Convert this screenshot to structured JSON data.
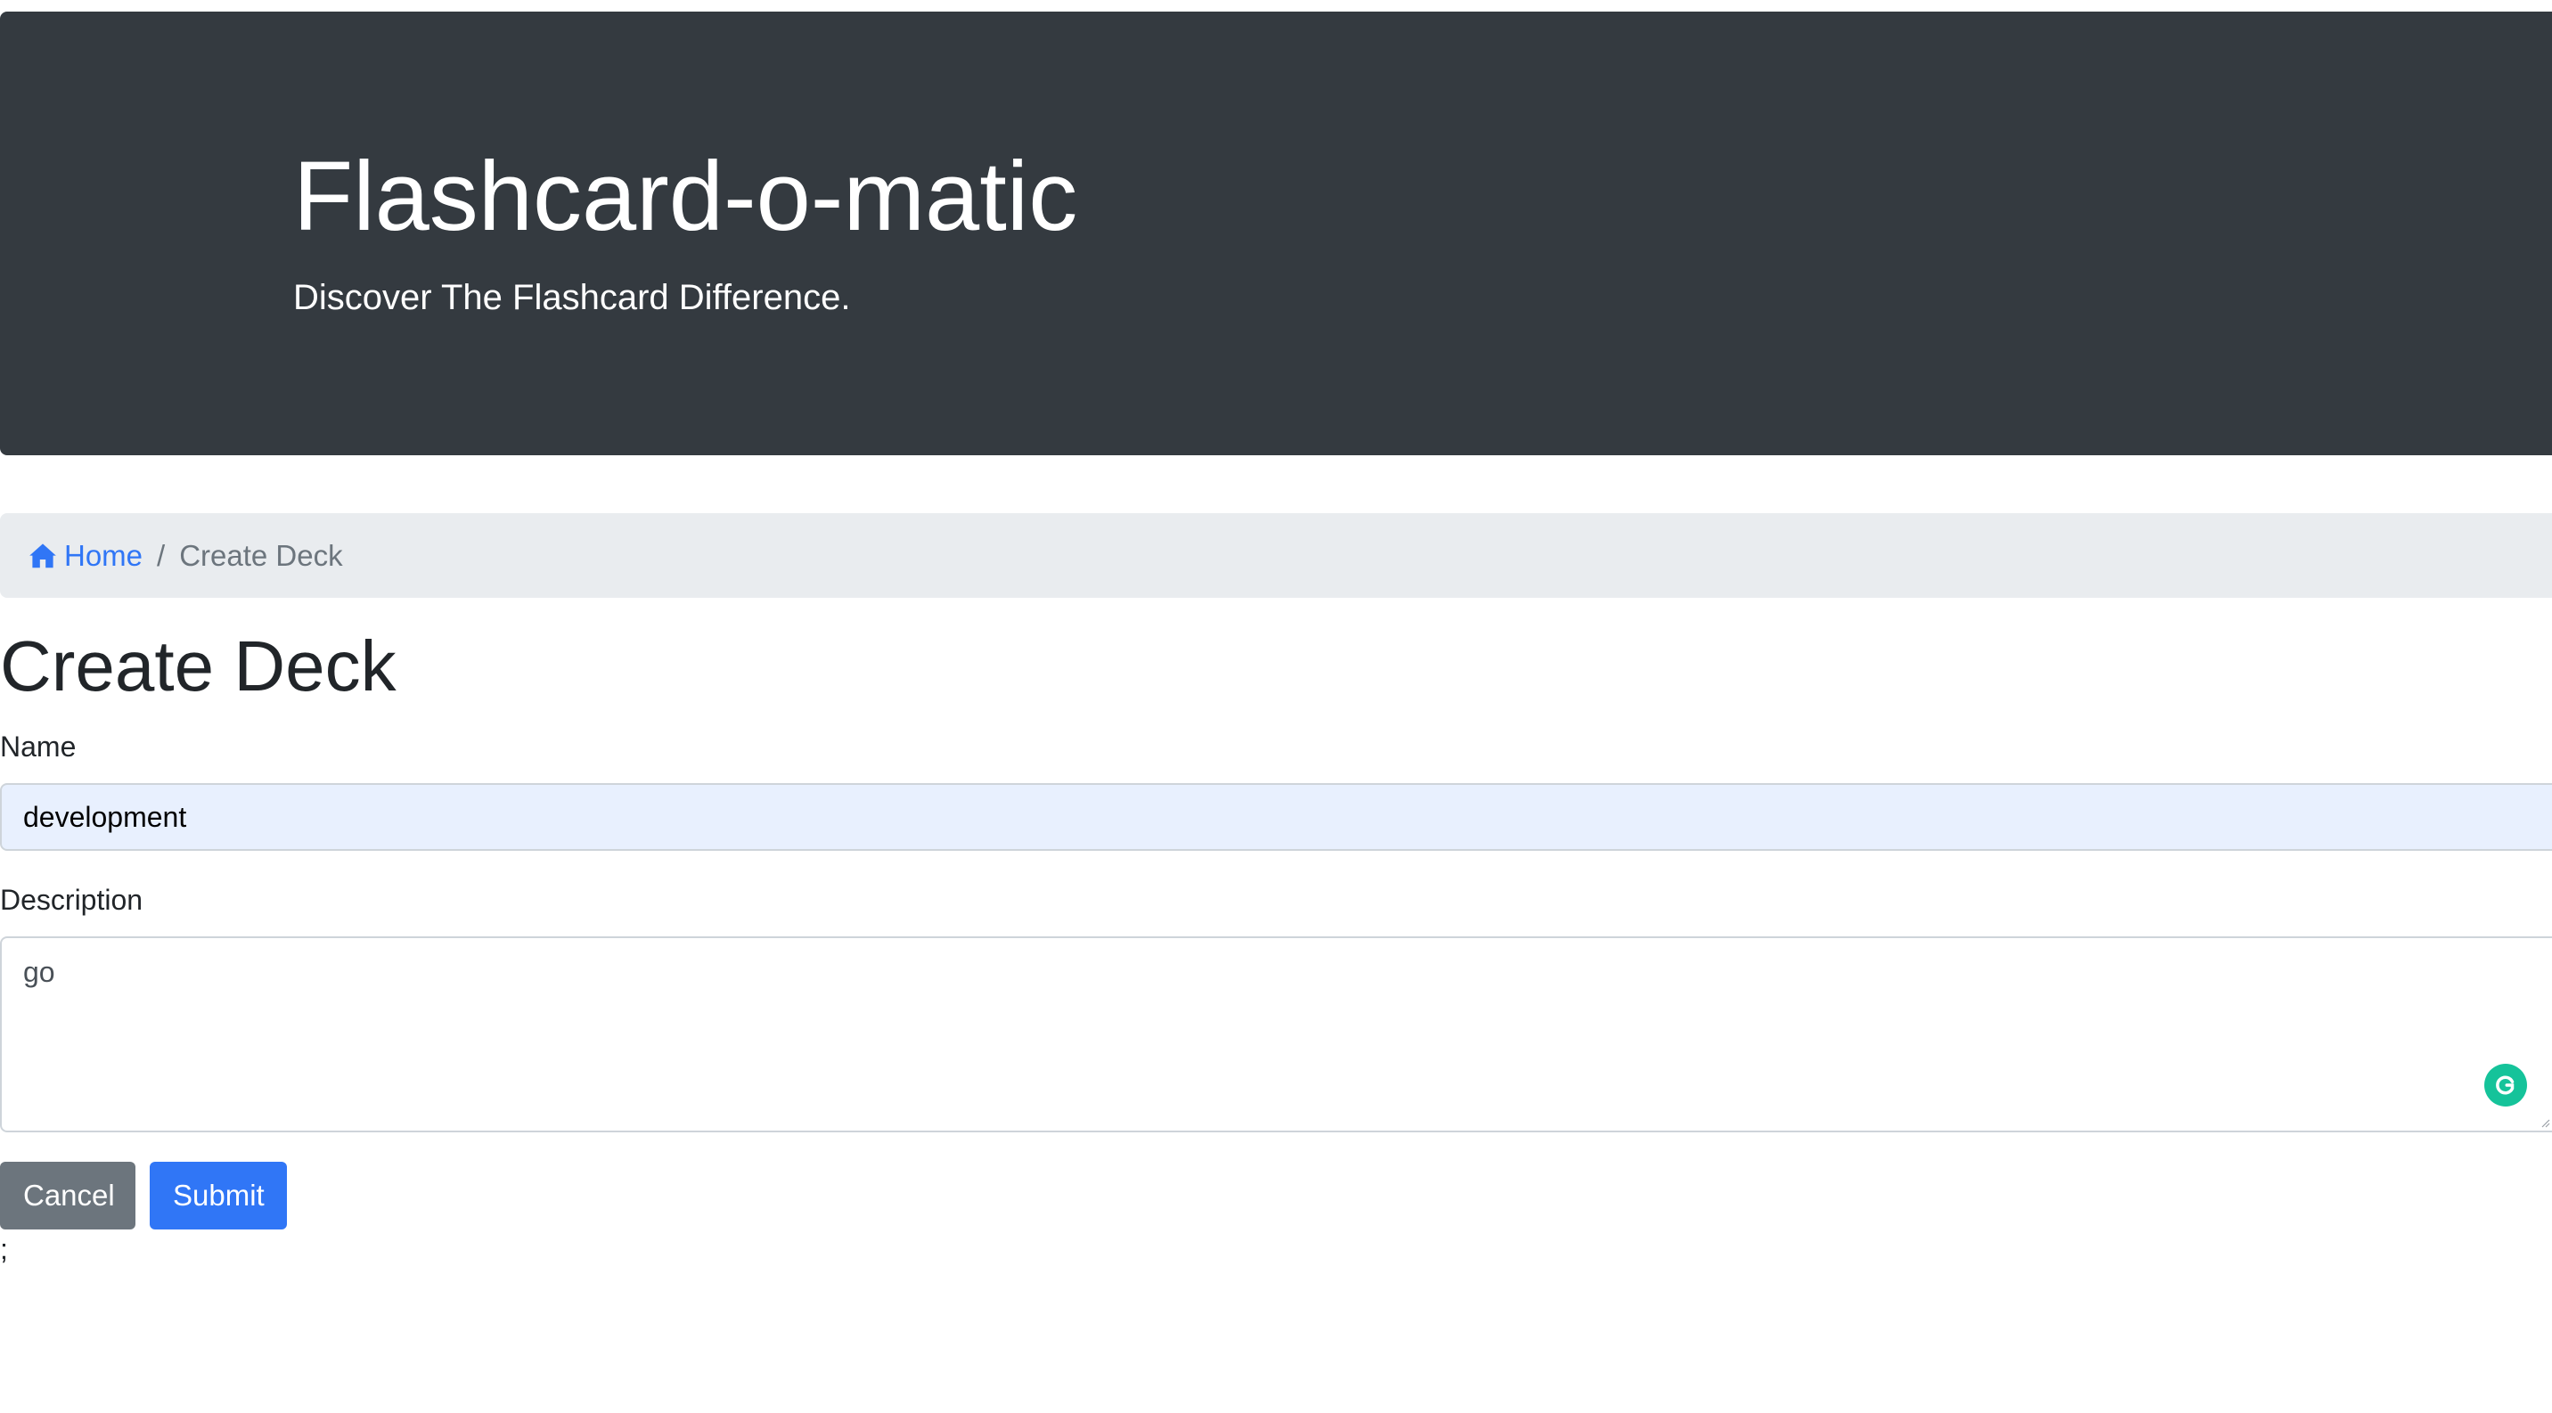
{
  "header": {
    "title": "Flashcard-o-matic",
    "tagline": "Discover The Flashcard Difference."
  },
  "breadcrumb": {
    "home_label": "Home",
    "home_icon": "house-icon",
    "separator": "/",
    "current_label": "Create Deck"
  },
  "page": {
    "heading": "Create Deck"
  },
  "form": {
    "name_label": "Name",
    "name_value": "development",
    "description_label": "Description",
    "description_value": "go",
    "cancel_label": "Cancel",
    "submit_label": "Submit"
  },
  "footer": {
    "stray_text": ";"
  },
  "colors": {
    "header_bg": "#343a40",
    "breadcrumb_bg": "#e9ecef",
    "link": "#3076f6",
    "cancel_bg": "#6c757d",
    "submit_bg": "#3076f6",
    "autofill_bg": "#e8f0fe",
    "grammarly": "#15c39a"
  }
}
